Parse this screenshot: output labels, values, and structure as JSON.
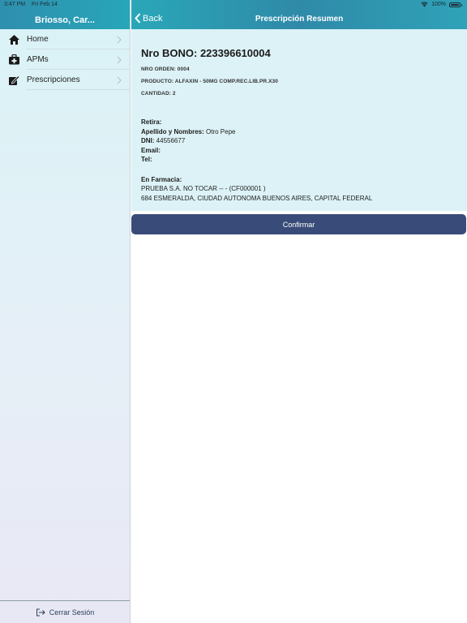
{
  "status_bar": {
    "time": "3:47 PM",
    "date": "Fri Feb 14",
    "battery": "100%"
  },
  "sidebar": {
    "user_name": "Briosso, Car...",
    "items": [
      {
        "label": "Home",
        "icon": "home-icon"
      },
      {
        "label": "APMs",
        "icon": "medkit-icon"
      },
      {
        "label": "Prescripciones",
        "icon": "edit-icon"
      }
    ],
    "logout_label": "Cerrar Sesión"
  },
  "header": {
    "back_label": "Back",
    "title": "Prescripción Resumen"
  },
  "summary": {
    "bono": "Nro BONO: 223396610004",
    "orden": "NRO ORDEN: 0004",
    "producto": "PRODUCTO: ALFAXIN - 50MG COMP.REC.LIB.PR.X30",
    "cantidad": "CANTIDAD: 2",
    "retira_label": "Retira:",
    "nombres_label": "Apellido y Nombres:",
    "nombres_value": " Otro Pepe",
    "dni_label": "DNI:",
    "dni_value": " 44556677",
    "email_label": "Email:",
    "email_value": "",
    "tel_label": "Tel:",
    "tel_value": "",
    "farmacia_label": "En Farmacia:",
    "farmacia_name": "PRUEBA S.A. NO TOCAR -- - (CF000001 )",
    "farmacia_address": "684 ESMERALDA, CIUDAD AUTONOMA BUENOS AIRES, CAPITAL FEDERAL"
  },
  "confirm_label": "Confirmar",
  "colors": {
    "header": "#2f8fae",
    "confirm": "#394b78",
    "content_bg": "#dcf2f6"
  }
}
